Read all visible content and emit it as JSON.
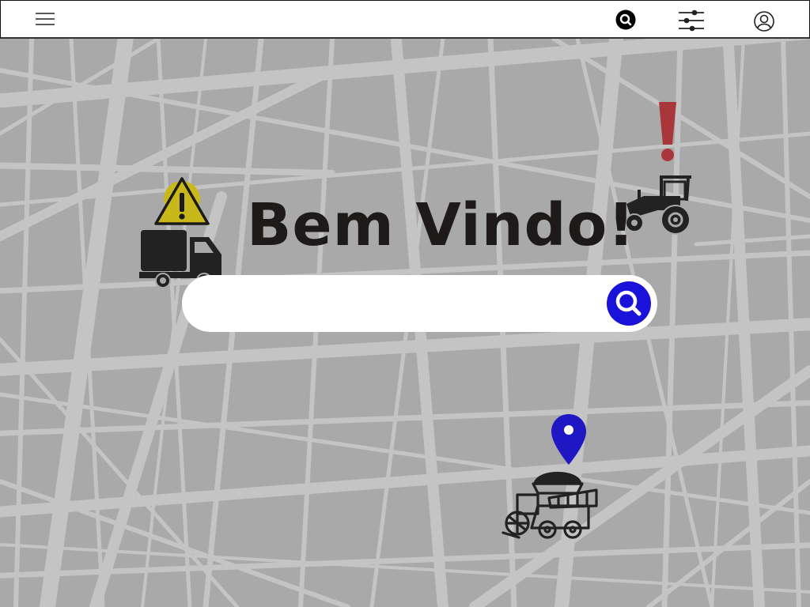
{
  "header": {
    "icons": {
      "menu": "hamburger-menu-icon",
      "search": "search-icon",
      "filters": "sliders-icon",
      "profile": "user-circle-icon"
    }
  },
  "main": {
    "welcome_text": "Bem Vindo!",
    "search": {
      "value": "",
      "placeholder": "",
      "button_icon": "search-icon"
    }
  },
  "map_markers": [
    {
      "icon": "warning-triangle-icon",
      "color": "#c9b81a"
    },
    {
      "icon": "truck-icon",
      "color": "#222222"
    },
    {
      "icon": "exclamation-icon",
      "color": "#a8363a"
    },
    {
      "icon": "tractor-icon",
      "color": "#222222"
    },
    {
      "icon": "location-pin-icon",
      "color": "#1f16c4"
    },
    {
      "icon": "harvester-icon",
      "color": "#222222"
    }
  ],
  "colors": {
    "map_background": "#a9a9a9",
    "map_roads": "#c4c4c4",
    "accent": "#1a12d8",
    "alert": "#a8363a",
    "warning": "#c9b81a"
  }
}
